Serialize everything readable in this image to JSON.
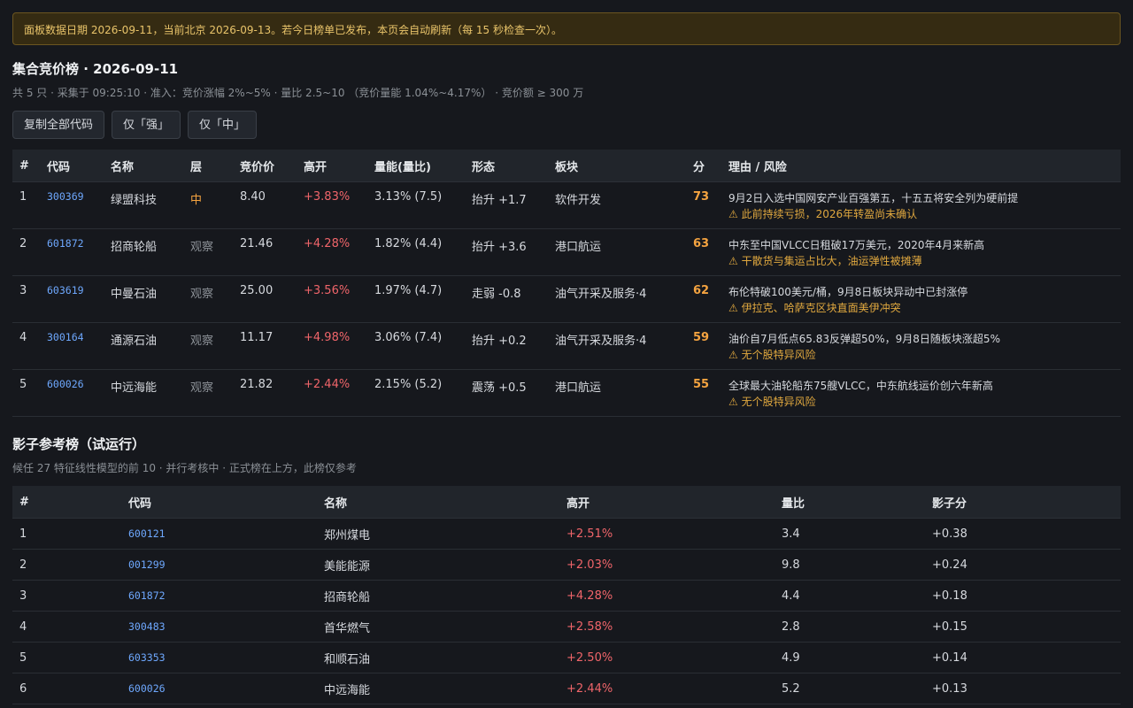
{
  "banner": "面板数据日期 2026-09-11，当前北京 2026-09-13。若今日榜单已发布，本页会自动刷新（每 15 秒检查一次）。",
  "main": {
    "title": "集合竞价榜 · 2026-09-11",
    "subtitle": "共 5 只 · 采集于 09:25:10 · 准入：竞价涨幅 2%~5% · 量比 2.5~10 （竞价量能 1.04%~4.17%） · 竞价额 ≥ 300 万",
    "buttons": {
      "copy_all": "复制全部代码",
      "only_strong": "仅「强」",
      "only_mid": "仅「中」"
    },
    "columns": [
      "#",
      "代码",
      "名称",
      "层",
      "竞价价",
      "高开",
      "量能(量比)",
      "形态",
      "板块",
      "分",
      "理由 / 风险"
    ],
    "rows": [
      {
        "idx": "1",
        "code": "300369",
        "name": "绿盟科技",
        "tier": "中",
        "tier_type": "strong",
        "price": "8.40",
        "open": "+3.83%",
        "vol": "3.13% (7.5)",
        "pattern": "抬升 +1.7",
        "sector": "软件开发",
        "score": "73",
        "reason": "9月2日入选中国网安产业百强第五，十五五将安全列为硬前提",
        "risk": "⚠ 此前持续亏损，2026年转盈尚未确认"
      },
      {
        "idx": "2",
        "code": "601872",
        "name": "招商轮船",
        "tier": "观察",
        "tier_type": "watch",
        "price": "21.46",
        "open": "+4.28%",
        "vol": "1.82% (4.4)",
        "pattern": "抬升 +3.6",
        "sector": "港口航运",
        "score": "63",
        "reason": "中东至中国VLCC日租破17万美元，2020年4月来新高",
        "risk": "⚠ 干散货与集运占比大，油运弹性被摊薄"
      },
      {
        "idx": "3",
        "code": "603619",
        "name": "中曼石油",
        "tier": "观察",
        "tier_type": "watch",
        "price": "25.00",
        "open": "+3.56%",
        "vol": "1.97% (4.7)",
        "pattern": "走弱 -0.8",
        "sector": "油气开采及服务·4",
        "score": "62",
        "reason": "布伦特破100美元/桶，9月8日板块异动中已封涨停",
        "risk": "⚠ 伊拉克、哈萨克区块直面美伊冲突"
      },
      {
        "idx": "4",
        "code": "300164",
        "name": "通源石油",
        "tier": "观察",
        "tier_type": "watch",
        "price": "11.17",
        "open": "+4.98%",
        "vol": "3.06% (7.4)",
        "pattern": "抬升 +0.2",
        "sector": "油气开采及服务·4",
        "score": "59",
        "reason": "油价自7月低点65.83反弹超50%，9月8日随板块涨超5%",
        "risk": "⚠ 无个股特异风险"
      },
      {
        "idx": "5",
        "code": "600026",
        "name": "中远海能",
        "tier": "观察",
        "tier_type": "watch",
        "price": "21.82",
        "open": "+2.44%",
        "vol": "2.15% (5.2)",
        "pattern": "震荡 +0.5",
        "sector": "港口航运",
        "score": "55",
        "reason": "全球最大油轮船东75艘VLCC，中东航线运价创六年新高",
        "risk": "⚠ 无个股特异风险"
      }
    ]
  },
  "shadow": {
    "title": "影子参考榜（试运行）",
    "subtitle": "候任 27 特征线性模型的前 10 · 并行考核中 · 正式榜在上方，此榜仅参考",
    "columns": [
      "#",
      "代码",
      "名称",
      "高开",
      "量比",
      "影子分"
    ],
    "rows": [
      {
        "idx": "1",
        "code": "600121",
        "name": "郑州煤电",
        "open": "+2.51%",
        "ratio": "3.4",
        "score": "+0.38"
      },
      {
        "idx": "2",
        "code": "001299",
        "name": "美能能源",
        "open": "+2.03%",
        "ratio": "9.8",
        "score": "+0.24"
      },
      {
        "idx": "3",
        "code": "601872",
        "name": "招商轮船",
        "open": "+4.28%",
        "ratio": "4.4",
        "score": "+0.18"
      },
      {
        "idx": "4",
        "code": "300483",
        "name": "首华燃气",
        "open": "+2.58%",
        "ratio": "2.8",
        "score": "+0.15"
      },
      {
        "idx": "5",
        "code": "603353",
        "name": "和顺石油",
        "open": "+2.50%",
        "ratio": "4.9",
        "score": "+0.14"
      },
      {
        "idx": "6",
        "code": "600026",
        "name": "中远海能",
        "open": "+2.44%",
        "ratio": "5.2",
        "score": "+0.13"
      }
    ]
  }
}
